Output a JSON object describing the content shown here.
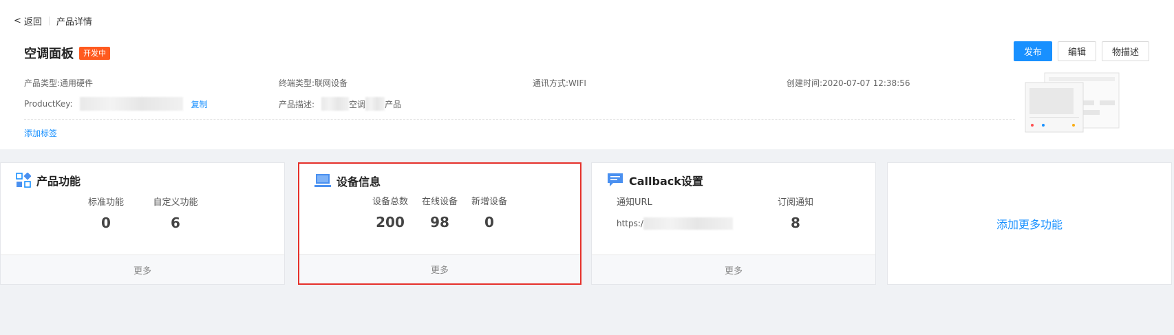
{
  "breadcrumb": {
    "back_label": "返回",
    "current": "产品详情"
  },
  "product": {
    "name": "空调面板",
    "status_badge": "开发中",
    "type_label": "产品类型:",
    "type_value": "通用硬件",
    "terminal_label": "终端类型:",
    "terminal_value": "联网设备",
    "comm_label": "通讯方式:",
    "comm_value": "WIFI",
    "created_label": "创建时间:",
    "created_value": "2020-07-07 12:38:56",
    "productkey_label": "ProductKey:",
    "copy_label": "复制",
    "desc_label": "产品描述:",
    "desc_visible_1": "空调",
    "desc_visible_2": "产品",
    "add_tag_label": "添加标签"
  },
  "actions": {
    "publish": "发布",
    "edit": "编辑",
    "thing_desc": "物描述"
  },
  "cards": {
    "features": {
      "title": "产品功能",
      "stats": [
        {
          "label": "标准功能",
          "value": "0"
        },
        {
          "label": "自定义功能",
          "value": "6"
        }
      ],
      "more": "更多"
    },
    "devices": {
      "title": "设备信息",
      "stats": [
        {
          "label": "设备总数",
          "value": "200"
        },
        {
          "label": "在线设备",
          "value": "98"
        },
        {
          "label": "新增设备",
          "value": "0"
        }
      ],
      "more": "更多"
    },
    "callback": {
      "title": "Callback设置",
      "url_label": "通知URL",
      "url_prefix": "https:/",
      "sub_label": "订阅通知",
      "sub_value": "8",
      "more": "更多"
    },
    "add_more": {
      "label": "添加更多功能"
    }
  },
  "colors": {
    "primary": "#1890ff",
    "badge": "#ff5a1f",
    "highlight": "#e5302a"
  }
}
